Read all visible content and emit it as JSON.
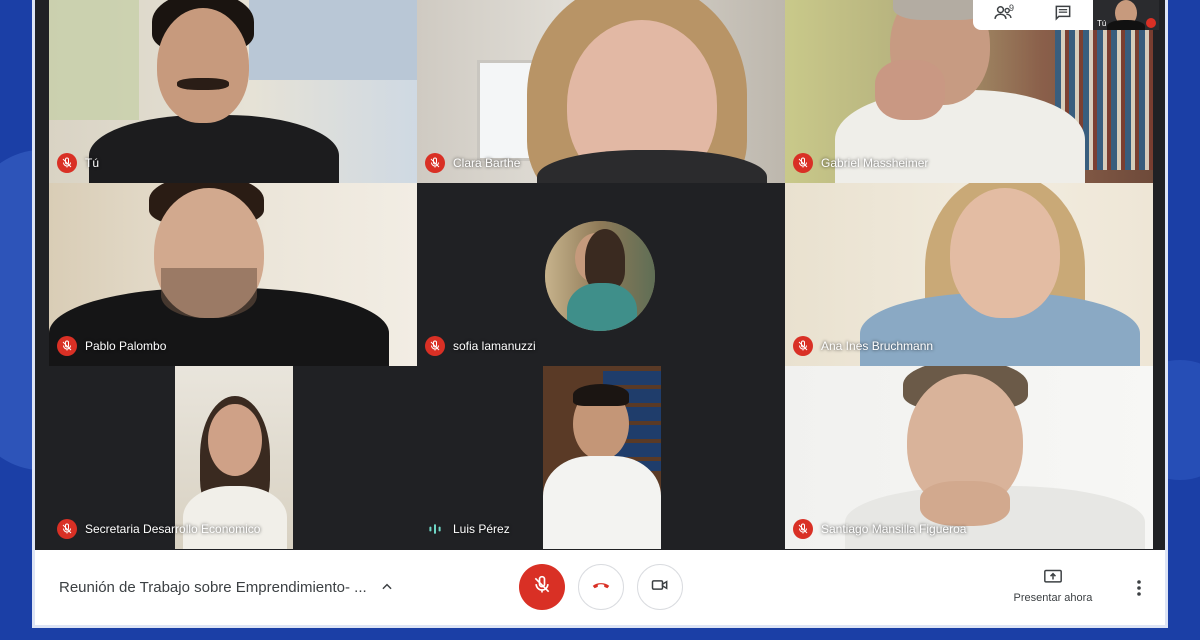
{
  "participants": [
    {
      "name": "Tú",
      "muted": true
    },
    {
      "name": "Clara Barthe",
      "muted": true
    },
    {
      "name": "Gabriel Massheimer",
      "muted": true
    },
    {
      "name": "Pablo Palombo",
      "muted": true
    },
    {
      "name": "sofia lamanuzzi",
      "muted": true
    },
    {
      "name": "Ana Ines Bruchmann",
      "muted": true
    },
    {
      "name": "Secretaria Desarrollo Economico",
      "muted": true
    },
    {
      "name": "Luis Pérez",
      "muted": false
    },
    {
      "name": "Santiago Mansilla Figueroa",
      "muted": true
    }
  ],
  "topbar": {
    "people_count": "9",
    "people_icon": "people-icon",
    "chat_icon": "chat-icon",
    "self_label": "Tú"
  },
  "bottombar": {
    "meeting_title": "Reunión de Trabajo sobre Emprendimiento- ...",
    "present_label": "Presentar ahora"
  },
  "colors": {
    "mute_red": "#d93025",
    "page_bg": "#1b3fa6",
    "speaking_teal": "#6fd6c6"
  }
}
